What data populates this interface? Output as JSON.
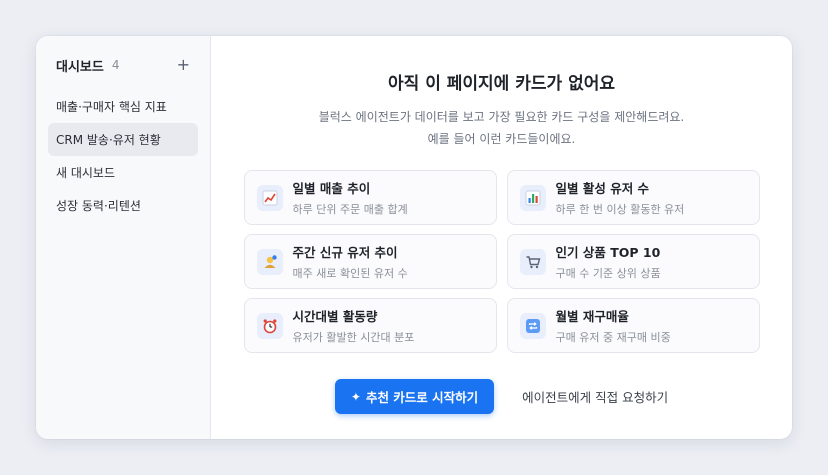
{
  "sidebar": {
    "title": "대시보드",
    "count": "4",
    "add_icon": "+",
    "items": [
      {
        "label": "매출·구매자 핵심 지표",
        "active": false
      },
      {
        "label": "CRM 발송·유저 현황",
        "active": true
      },
      {
        "label": "새 대시보드",
        "active": false
      },
      {
        "label": "성장 동력·리텐션",
        "active": false
      }
    ]
  },
  "main": {
    "headline": "아직 이 페이지에 카드가 없어요",
    "subline_1": "블럭스 에이전트가 데이터를 보고 가장 필요한 카드 구성을 제안해드려요.",
    "subline_2": "예를 들어 이런 카드들이에요.",
    "cards": [
      {
        "title": "일별 매출 추이",
        "desc": "하루 단위 주문 매출 합계",
        "icon": "line-chart-icon"
      },
      {
        "title": "일별 활성 유저 수",
        "desc": "하루 한 번 이상 활동한 유저",
        "icon": "bar-chart-icon"
      },
      {
        "title": "주간 신규 유저 추이",
        "desc": "매주 새로 확인된 유저 수",
        "icon": "new-user-icon"
      },
      {
        "title": "인기 상품 TOP 10",
        "desc": "구매 수 기준 상위 상품",
        "icon": "cart-icon"
      },
      {
        "title": "시간대별 활동량",
        "desc": "유저가 활발한 시간대 분포",
        "icon": "alarm-clock-icon"
      },
      {
        "title": "월별 재구매율",
        "desc": "구매 유저 중 재구매 비중",
        "icon": "repeat-icon"
      }
    ],
    "primary_button": "추천 카드로 시작하기",
    "primary_icon": "✦",
    "secondary_button": "에이전트에게 직접 요청하기"
  },
  "colors": {
    "accent": "#1a73f0",
    "background": "#eceef4",
    "sidebar_active": "#e8eaef"
  }
}
